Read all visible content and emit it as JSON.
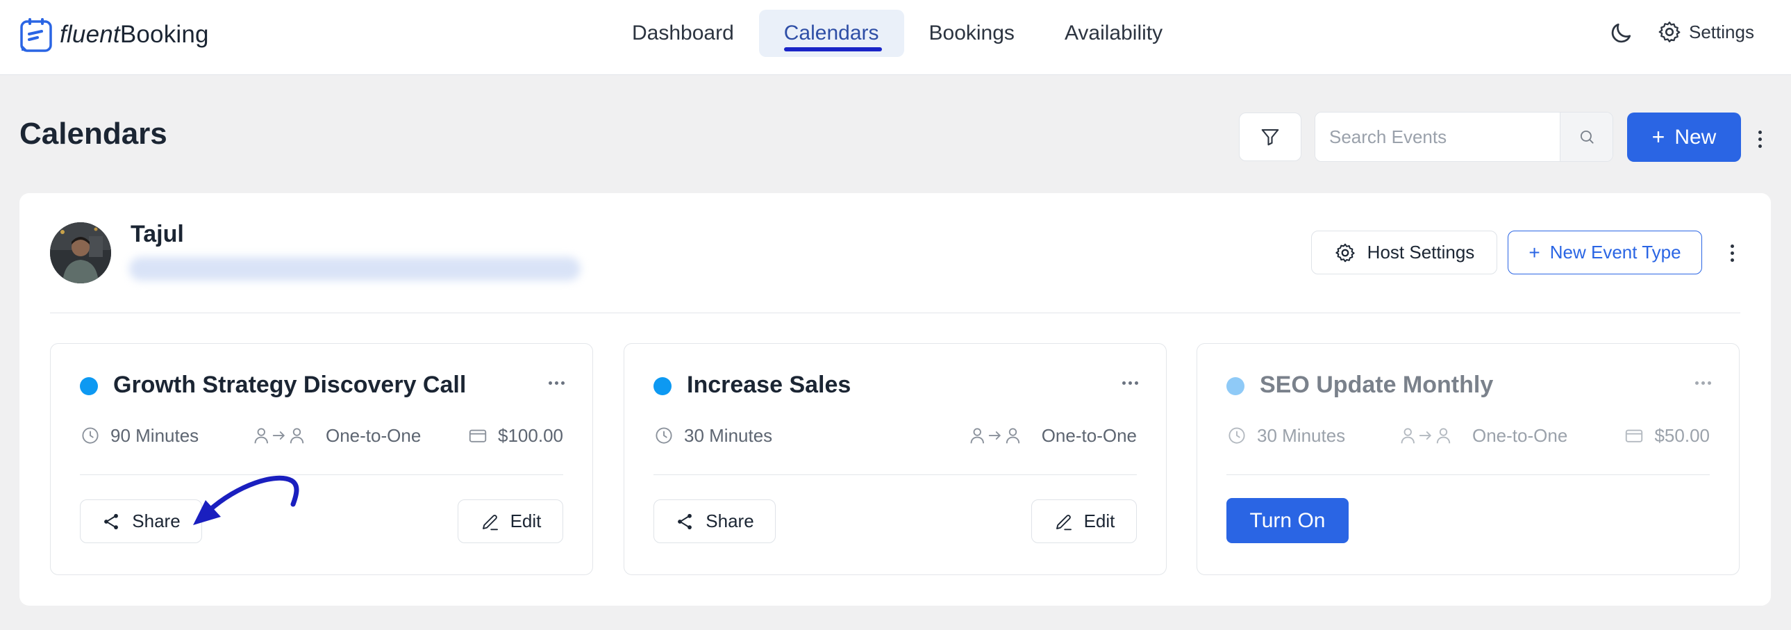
{
  "app": {
    "logo_part1": "fluent",
    "logo_part2": "Booking",
    "nav": [
      {
        "label": "Dashboard",
        "active": false
      },
      {
        "label": "Calendars",
        "active": true
      },
      {
        "label": "Bookings",
        "active": false
      },
      {
        "label": "Availability",
        "active": false
      }
    ],
    "settings_label": "Settings",
    "theme_icon": "moon-icon"
  },
  "page": {
    "title": "Calendars",
    "search_placeholder": "Search Events",
    "search_value": "",
    "new_button": "New"
  },
  "host": {
    "name": "Tajul",
    "host_settings_label": "Host Settings",
    "new_event_type_label": "New Event Type"
  },
  "events": [
    {
      "title": "Growth Strategy Discovery Call",
      "dot_color": "#0d99f2",
      "duration": "90 Minutes",
      "type": "One-to-One",
      "price": "$100.00",
      "share_label": "Share",
      "edit_label": "Edit",
      "enabled": true
    },
    {
      "title": "Increase Sales",
      "dot_color": "#0d99f2",
      "duration": "30 Minutes",
      "type": "One-to-One",
      "price": "",
      "share_label": "Share",
      "edit_label": "Edit",
      "enabled": true
    },
    {
      "title": "SEO Update Monthly",
      "dot_color": "#8fcaf7",
      "duration": "30 Minutes",
      "type": "One-to-One",
      "price": "$50.00",
      "turn_on_label": "Turn On",
      "enabled": false
    }
  ],
  "colors": {
    "accent": "#2a65e4",
    "nav_underline": "#1a25c7",
    "annotation": "#1a1fbf",
    "background": "#f0f0f1"
  }
}
